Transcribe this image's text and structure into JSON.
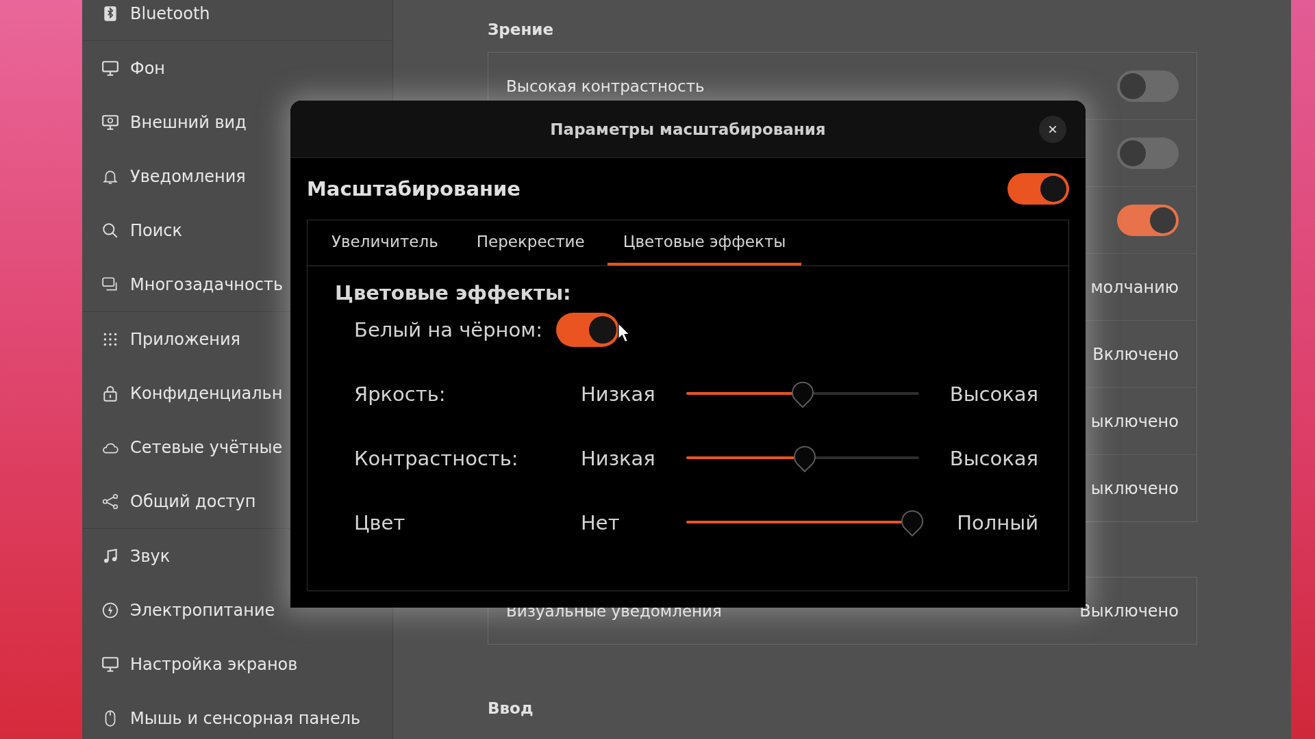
{
  "sidebar": {
    "sections": [
      {
        "items": [
          {
            "label": "Bluetooth"
          }
        ]
      },
      {
        "items": [
          {
            "label": "Фон"
          },
          {
            "label": "Внешний вид"
          },
          {
            "label": "Уведомления"
          },
          {
            "label": "Поиск"
          },
          {
            "label": "Многозадачность"
          }
        ]
      },
      {
        "items": [
          {
            "label": "Приложения"
          },
          {
            "label": "Конфиденциальн"
          },
          {
            "label": "Сетевые учётные"
          },
          {
            "label": "Общий доступ"
          }
        ]
      },
      {
        "items": [
          {
            "label": "Звук"
          },
          {
            "label": "Электропитание"
          },
          {
            "label": "Настройка экранов"
          },
          {
            "label": "Мышь и сенсорная панель"
          }
        ]
      }
    ]
  },
  "main": {
    "sections": [
      {
        "title": "Зрение",
        "rows": [
          {
            "kind": "switch",
            "label": "Высокая контрастность",
            "on": false
          },
          {
            "kind": "switch",
            "on": false
          },
          {
            "kind": "switch",
            "on": true
          },
          {
            "kind": "value",
            "value": "молчанию"
          },
          {
            "kind": "value",
            "value": "Включено"
          },
          {
            "kind": "value",
            "value": "ыключено"
          },
          {
            "kind": "value",
            "value": "ыключено"
          }
        ]
      },
      {
        "rows": [
          {
            "kind": "value",
            "label": "Визуальные уведомления",
            "value": "Выключено"
          }
        ]
      },
      {
        "title": "Ввод"
      }
    ]
  },
  "dialog": {
    "title": "Параметры масштабирования",
    "heading": "Масштабирование",
    "on": true,
    "tabs": [
      {
        "label": "Увеличитель",
        "selected": false
      },
      {
        "label": "Перекрестие",
        "selected": false
      },
      {
        "label": "Цветовые эффекты",
        "selected": true
      }
    ],
    "group_title": "Цветовые эффекты:",
    "invert": {
      "label": "Белый на чёрном:",
      "on": true
    },
    "sliders": [
      {
        "label": "Яркость:",
        "low": "Низкая",
        "high": "Высокая",
        "level": 0.5
      },
      {
        "label": "Контрастность:",
        "low": "Низкая",
        "high": "Высокая",
        "level": 0.51
      },
      {
        "label": "Цвет",
        "low": "Нет",
        "high": "Полный",
        "level": 0.97
      }
    ]
  }
}
